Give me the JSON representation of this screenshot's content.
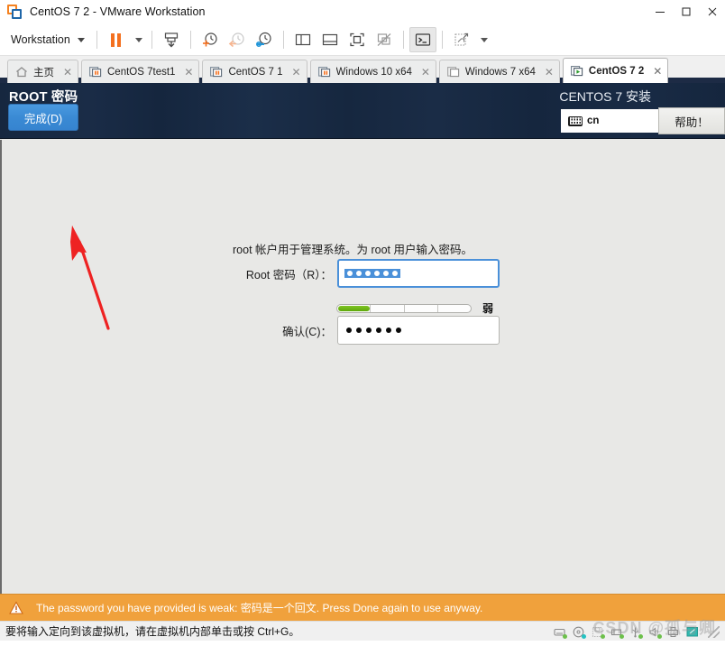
{
  "window": {
    "title": "CentOS 7 2 - VMware Workstation",
    "app_icon": "vmware-logo-icon",
    "controls": {
      "minimize": "minimize-icon",
      "maximize": "maximize-icon",
      "close": "close-icon"
    }
  },
  "toolbar": {
    "menu_label": "Workstation",
    "buttons": [
      {
        "name": "pause-vm",
        "icon": "pause-icon"
      },
      {
        "name": "pause-dropdown",
        "icon": "chevron-down-icon"
      },
      {
        "name": "send-ctrl-alt-del",
        "icon": "keyboard-send-icon"
      },
      {
        "name": "take-snapshot",
        "icon": "snapshot-add-icon"
      },
      {
        "name": "revert-snapshot",
        "icon": "snapshot-revert-icon"
      },
      {
        "name": "snapshot-manager",
        "icon": "snapshot-manager-icon"
      },
      {
        "name": "show-sidebar",
        "icon": "sidebar-panel-icon"
      },
      {
        "name": "show-thumbnail-bar",
        "icon": "thumbnail-bar-icon"
      },
      {
        "name": "full-screen",
        "icon": "fullscreen-icon"
      },
      {
        "name": "unity-mode",
        "icon": "unity-mode-icon"
      },
      {
        "name": "console-view",
        "icon": "console-icon"
      },
      {
        "name": "vm-settings",
        "icon": "vm-settings-icon"
      },
      {
        "name": "vm-settings-dropdown",
        "icon": "chevron-down-icon"
      }
    ]
  },
  "tabs": [
    {
      "label": "主页",
      "icon": "home-icon",
      "selected": false,
      "closable": true
    },
    {
      "label": "CentOS 7test1",
      "icon": "vm-running-icon",
      "selected": false,
      "closable": true
    },
    {
      "label": "CentOS 7 1",
      "icon": "vm-running-icon",
      "selected": false,
      "closable": true
    },
    {
      "label": "Windows 10 x64",
      "icon": "vm-running-icon",
      "selected": false,
      "closable": true
    },
    {
      "label": "Windows 7 x64",
      "icon": "vm-stopped-icon",
      "selected": false,
      "closable": true
    },
    {
      "label": "CentOS 7 2",
      "icon": "vm-play-icon",
      "selected": true,
      "closable": true
    }
  ],
  "installer": {
    "header_title": "ROOT 密码",
    "done_button": "完成(D)",
    "product_title": "CENTOS 7 安装",
    "keyboard_layout": "cn",
    "keyboard_icon": "keyboard-icon",
    "help_button": "帮助！",
    "intro_text": "root 帐户用于管理系统。为 root 用户输入密码。",
    "fields": [
      {
        "label": "Root 密码（R）：",
        "value_dots": 6,
        "selected": true,
        "focused": true
      },
      {
        "label": "确认(C)：",
        "value_dots": 6,
        "selected": false,
        "focused": false
      }
    ],
    "strength": {
      "label": "弱",
      "percent": 25,
      "segments": 4,
      "fill_color": "#5ea80b"
    },
    "warning": {
      "icon": "warning-triangle-icon",
      "text": "The password you have provided is weak: 密码是一个回文. Press Done again to use anyway."
    },
    "colors": {
      "header_bg": "#15263f",
      "body_bg": "#e8e8e6",
      "accent_blue": "#4a90d9",
      "warning_bg": "#f0a13c"
    }
  },
  "annotation": {
    "arrow": "red-arrow-annotation",
    "color": "#ee2222"
  },
  "statusbar": {
    "text": "要将输入定向到该虚拟机，请在虚拟机内部单击或按 Ctrl+G。",
    "icons": [
      {
        "name": "hard-disk-status-icon"
      },
      {
        "name": "cd-dvd-status-icon"
      },
      {
        "name": "floppy-status-icon"
      },
      {
        "name": "network-status-icon"
      },
      {
        "name": "usb-status-icon"
      },
      {
        "name": "sound-status-icon"
      },
      {
        "name": "printer-status-icon"
      },
      {
        "name": "display-status-icon"
      }
    ],
    "resize_grip": "resize-grip-icon"
  },
  "watermark": {
    "text": "CSDN @孤与卿"
  }
}
